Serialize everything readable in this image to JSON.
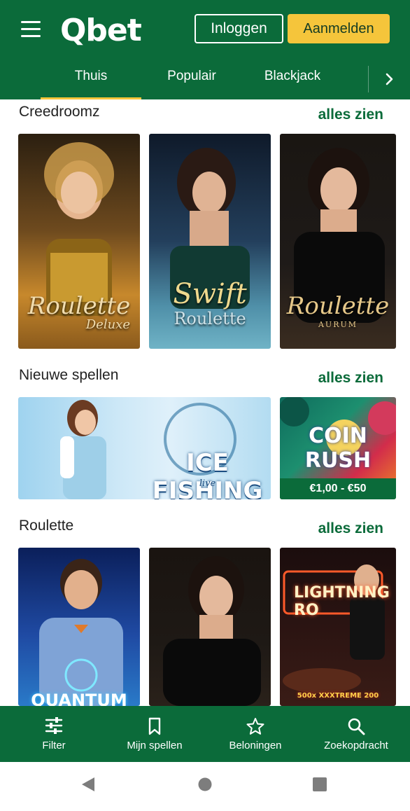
{
  "header": {
    "logo": "Qbet",
    "login_label": "Inloggen",
    "signup_label": "Aanmelden",
    "menu_icon": "hamburger-icon"
  },
  "tabs": [
    {
      "label": "Thuis",
      "active": true
    },
    {
      "label": "Populair",
      "active": false
    },
    {
      "label": "Blackjack",
      "active": false
    }
  ],
  "tabs_more_icon": "chevron-right-icon",
  "sections": [
    {
      "title": "Creedroomz",
      "see_all": "alles zien",
      "games": [
        {
          "name": "Roulette",
          "sub": "Deluxe"
        },
        {
          "name": "Swift",
          "sub": "Roulette"
        },
        {
          "name": "Roulette",
          "sub": "AURUM"
        }
      ]
    },
    {
      "title": "Nieuwe spellen",
      "see_all": "alles zien",
      "games": [
        {
          "name": "ICE FISHING",
          "sub": "live"
        },
        {
          "name": "COIN RUSH",
          "sub": "",
          "caption": "€1,00 - €50"
        }
      ]
    },
    {
      "title": "Roulette",
      "see_all": "alles zien",
      "games": [
        {
          "name": "QUANTUM",
          "sub": ""
        },
        {
          "name": "",
          "sub": ""
        },
        {
          "name": "LIGHTNING RO",
          "sub": "500x XXXTREME 200"
        }
      ]
    }
  ],
  "bottom_nav": [
    {
      "label": "Filter",
      "icon": "filter-sliders-icon"
    },
    {
      "label": "Mijn spellen",
      "icon": "bookmark-icon"
    },
    {
      "label": "Beloningen",
      "icon": "star-icon"
    },
    {
      "label": "Zoekopdracht",
      "icon": "search-icon"
    }
  ],
  "system_nav": [
    "back-icon",
    "home-icon",
    "recents-icon"
  ],
  "colors": {
    "brand_green": "#0b6b3a",
    "accent_yellow": "#f5c53b",
    "text_dark": "#222222"
  }
}
